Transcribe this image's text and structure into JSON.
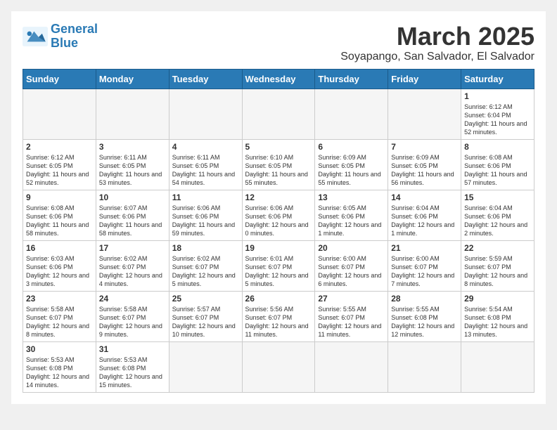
{
  "logo": {
    "line1": "General",
    "line2": "Blue"
  },
  "header": {
    "month": "March 2025",
    "location": "Soyapango, San Salvador, El Salvador"
  },
  "weekdays": [
    "Sunday",
    "Monday",
    "Tuesday",
    "Wednesday",
    "Thursday",
    "Friday",
    "Saturday"
  ],
  "days": [
    {
      "num": "",
      "info": ""
    },
    {
      "num": "",
      "info": ""
    },
    {
      "num": "",
      "info": ""
    },
    {
      "num": "",
      "info": ""
    },
    {
      "num": "",
      "info": ""
    },
    {
      "num": "",
      "info": ""
    },
    {
      "num": "1",
      "info": "Sunrise: 6:12 AM\nSunset: 6:04 PM\nDaylight: 11 hours\nand 52 minutes."
    },
    {
      "num": "2",
      "info": "Sunrise: 6:12 AM\nSunset: 6:05 PM\nDaylight: 11 hours\nand 52 minutes."
    },
    {
      "num": "3",
      "info": "Sunrise: 6:11 AM\nSunset: 6:05 PM\nDaylight: 11 hours\nand 53 minutes."
    },
    {
      "num": "4",
      "info": "Sunrise: 6:11 AM\nSunset: 6:05 PM\nDaylight: 11 hours\nand 54 minutes."
    },
    {
      "num": "5",
      "info": "Sunrise: 6:10 AM\nSunset: 6:05 PM\nDaylight: 11 hours\nand 55 minutes."
    },
    {
      "num": "6",
      "info": "Sunrise: 6:09 AM\nSunset: 6:05 PM\nDaylight: 11 hours\nand 55 minutes."
    },
    {
      "num": "7",
      "info": "Sunrise: 6:09 AM\nSunset: 6:05 PM\nDaylight: 11 hours\nand 56 minutes."
    },
    {
      "num": "8",
      "info": "Sunrise: 6:08 AM\nSunset: 6:06 PM\nDaylight: 11 hours\nand 57 minutes."
    },
    {
      "num": "9",
      "info": "Sunrise: 6:08 AM\nSunset: 6:06 PM\nDaylight: 11 hours\nand 58 minutes."
    },
    {
      "num": "10",
      "info": "Sunrise: 6:07 AM\nSunset: 6:06 PM\nDaylight: 11 hours\nand 58 minutes."
    },
    {
      "num": "11",
      "info": "Sunrise: 6:06 AM\nSunset: 6:06 PM\nDaylight: 11 hours\nand 59 minutes."
    },
    {
      "num": "12",
      "info": "Sunrise: 6:06 AM\nSunset: 6:06 PM\nDaylight: 12 hours\nand 0 minutes."
    },
    {
      "num": "13",
      "info": "Sunrise: 6:05 AM\nSunset: 6:06 PM\nDaylight: 12 hours\nand 1 minute."
    },
    {
      "num": "14",
      "info": "Sunrise: 6:04 AM\nSunset: 6:06 PM\nDaylight: 12 hours\nand 1 minute."
    },
    {
      "num": "15",
      "info": "Sunrise: 6:04 AM\nSunset: 6:06 PM\nDaylight: 12 hours\nand 2 minutes."
    },
    {
      "num": "16",
      "info": "Sunrise: 6:03 AM\nSunset: 6:06 PM\nDaylight: 12 hours\nand 3 minutes."
    },
    {
      "num": "17",
      "info": "Sunrise: 6:02 AM\nSunset: 6:07 PM\nDaylight: 12 hours\nand 4 minutes."
    },
    {
      "num": "18",
      "info": "Sunrise: 6:02 AM\nSunset: 6:07 PM\nDaylight: 12 hours\nand 5 minutes."
    },
    {
      "num": "19",
      "info": "Sunrise: 6:01 AM\nSunset: 6:07 PM\nDaylight: 12 hours\nand 5 minutes."
    },
    {
      "num": "20",
      "info": "Sunrise: 6:00 AM\nSunset: 6:07 PM\nDaylight: 12 hours\nand 6 minutes."
    },
    {
      "num": "21",
      "info": "Sunrise: 6:00 AM\nSunset: 6:07 PM\nDaylight: 12 hours\nand 7 minutes."
    },
    {
      "num": "22",
      "info": "Sunrise: 5:59 AM\nSunset: 6:07 PM\nDaylight: 12 hours\nand 8 minutes."
    },
    {
      "num": "23",
      "info": "Sunrise: 5:58 AM\nSunset: 6:07 PM\nDaylight: 12 hours\nand 8 minutes."
    },
    {
      "num": "24",
      "info": "Sunrise: 5:58 AM\nSunset: 6:07 PM\nDaylight: 12 hours\nand 9 minutes."
    },
    {
      "num": "25",
      "info": "Sunrise: 5:57 AM\nSunset: 6:07 PM\nDaylight: 12 hours\nand 10 minutes."
    },
    {
      "num": "26",
      "info": "Sunrise: 5:56 AM\nSunset: 6:07 PM\nDaylight: 12 hours\nand 11 minutes."
    },
    {
      "num": "27",
      "info": "Sunrise: 5:55 AM\nSunset: 6:07 PM\nDaylight: 12 hours\nand 11 minutes."
    },
    {
      "num": "28",
      "info": "Sunrise: 5:55 AM\nSunset: 6:08 PM\nDaylight: 12 hours\nand 12 minutes."
    },
    {
      "num": "29",
      "info": "Sunrise: 5:54 AM\nSunset: 6:08 PM\nDaylight: 12 hours\nand 13 minutes."
    },
    {
      "num": "30",
      "info": "Sunrise: 5:53 AM\nSunset: 6:08 PM\nDaylight: 12 hours\nand 14 minutes."
    },
    {
      "num": "31",
      "info": "Sunrise: 5:53 AM\nSunset: 6:08 PM\nDaylight: 12 hours\nand 15 minutes."
    },
    {
      "num": "",
      "info": ""
    },
    {
      "num": "",
      "info": ""
    },
    {
      "num": "",
      "info": ""
    },
    {
      "num": "",
      "info": ""
    },
    {
      "num": "",
      "info": ""
    }
  ]
}
